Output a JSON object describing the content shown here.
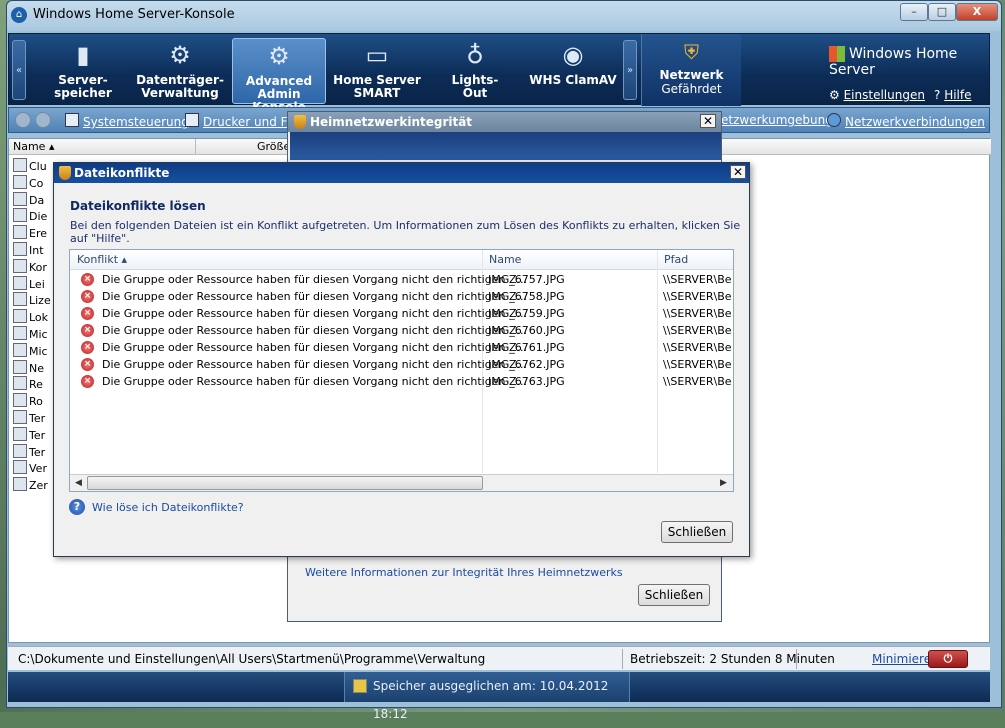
{
  "window": {
    "title": "Windows Home Server-Konsole",
    "min": "–",
    "max": "□",
    "close": "X"
  },
  "ribbon": {
    "tabs": [
      {
        "line1": "Server-",
        "line2": "speicher",
        "icon": "server-icon"
      },
      {
        "line1": "Datenträger-",
        "line2": "Verwaltung",
        "icon": "gear-icon"
      },
      {
        "line1": "Advanced",
        "line2": "Admin Konsole",
        "icon": "admin-console-icon"
      },
      {
        "line1": "Home Server",
        "line2": "SMART",
        "icon": "monitor-icon"
      },
      {
        "line1": "Lights-",
        "line2": "Out",
        "icon": "lightbulb-icon"
      },
      {
        "line1": "WHS ClamAV",
        "line2": "",
        "icon": "clamav-icon"
      }
    ],
    "network": {
      "line1": "Netzwerk",
      "line2": "Gefährdet"
    },
    "brand": "Windows Home Server",
    "settings": "Einstellungen",
    "help": "Hilfe"
  },
  "toolbar": {
    "items": [
      "Systemsteuerung",
      "Drucker und Faxg",
      "etzwerkumgebung",
      "Netzwerkverbindungen"
    ]
  },
  "list": {
    "columns": [
      "Name",
      "Größe"
    ],
    "items": [
      "Clu",
      "Co",
      "Da",
      "Die",
      "Ere",
      "Int",
      "Kor",
      "Lei",
      "Lize",
      "Lok",
      "Mic",
      "Mic",
      "Ne",
      "Re",
      "Ro",
      "Ter",
      "Ter",
      "Ter",
      "Ver",
      "Zer"
    ]
  },
  "status": {
    "path": "C:\\Dokumente und Einstellungen\\All Users\\Startmenü\\Programme\\Verwaltung",
    "uptime": "Betriebszeit: 2 Stunden 8 Minuten",
    "minimize": "Minimieren"
  },
  "taskbar": {
    "note": "Speicher ausgeglichen am: 10.04.2012 18:12"
  },
  "dialog_integrity": {
    "title": "Heimnetzwerkintegrität",
    "link": "Weitere Informationen zur Integrität Ihres Heimnetzwerks",
    "close_button": "Schließen"
  },
  "dialog_conflicts": {
    "title": "Dateikonflikte",
    "heading": "Dateikonflikte lösen",
    "description": "Bei den folgenden Dateien ist ein Konflikt aufgetreten. Um Informationen zum Lösen des Konflikts zu erhalten, klicken Sie auf \"Hilfe\".",
    "columns": {
      "conflict": "Konflikt",
      "name": "Name",
      "path": "Pfad"
    },
    "rows": [
      {
        "conflict": "Die Gruppe oder Ressource haben für diesen Vorgang nicht den richtigen Z...",
        "name": "IMG_6757.JPG",
        "path": "\\\\SERVER\\Ben"
      },
      {
        "conflict": "Die Gruppe oder Ressource haben für diesen Vorgang nicht den richtigen Z...",
        "name": "IMG_6758.JPG",
        "path": "\\\\SERVER\\Ben"
      },
      {
        "conflict": "Die Gruppe oder Ressource haben für diesen Vorgang nicht den richtigen Z...",
        "name": "IMG_6759.JPG",
        "path": "\\\\SERVER\\Ben"
      },
      {
        "conflict": "Die Gruppe oder Ressource haben für diesen Vorgang nicht den richtigen Z...",
        "name": "IMG_6760.JPG",
        "path": "\\\\SERVER\\Ben"
      },
      {
        "conflict": "Die Gruppe oder Ressource haben für diesen Vorgang nicht den richtigen Z...",
        "name": "IMG_6761.JPG",
        "path": "\\\\SERVER\\Ben"
      },
      {
        "conflict": "Die Gruppe oder Ressource haben für diesen Vorgang nicht den richtigen Z...",
        "name": "IMG_6762.JPG",
        "path": "\\\\SERVER\\Ben"
      },
      {
        "conflict": "Die Gruppe oder Ressource haben für diesen Vorgang nicht den richtigen Z...",
        "name": "IMG_6763.JPG",
        "path": "\\\\SERVER\\Ben"
      }
    ],
    "help_link": "Wie löse ich Dateikonflikte?",
    "close_button": "Schließen"
  },
  "colors": {
    "ribbon": "#0c2c57",
    "dialog_title": "#164f9f",
    "error": "#c21c1c",
    "link": "#1a4ba3"
  }
}
